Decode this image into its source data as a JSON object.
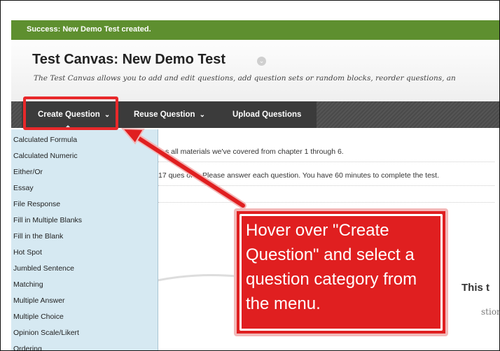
{
  "success_message": "Success: New Demo Test created.",
  "canvas": {
    "title": "Test Canvas: New Demo Test",
    "description": "The Test Canvas allows you to add and edit questions, add question sets or random blocks, reorder questions, an"
  },
  "toolbar": {
    "create": "Create Question",
    "reuse": "Reuse Question",
    "upload": "Upload Questions"
  },
  "content": {
    "line1": "s all materials we've covered from chapter 1 through 6.",
    "line2": "17 ques      ons. Please answer each question. You have 60 minutes to complete the test."
  },
  "menu": [
    "Calculated Formula",
    "Calculated Numeric",
    "Either/Or",
    "Essay",
    "File Response",
    "Fill in Multiple Blanks",
    "Fill in the Blank",
    "Hot Spot",
    "Jumbled Sentence",
    "Matching",
    "Multiple Answer",
    "Multiple Choice",
    "Opinion Scale/Likert",
    "Ordering"
  ],
  "right_heading": "This t",
  "right_sub": "stions",
  "callout": "Hover over \"Create Question\" and select a question category from the menu.",
  "colors": {
    "success": "#5e8f2f",
    "toolbar": "#3b3b3b",
    "menu": "#d6e9f2",
    "callout": "#e01f20"
  }
}
